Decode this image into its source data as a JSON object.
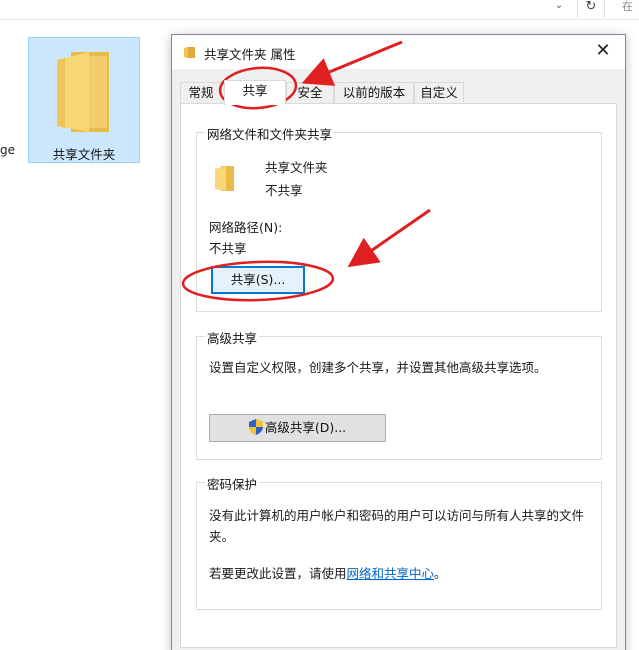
{
  "explorer": {
    "address_chevron": "⌄",
    "refresh_glyph": "↻",
    "search_stub": "在",
    "partial_item_text": "ge",
    "folder_label": "共享文件夹"
  },
  "dialog": {
    "title": "共享文件夹 属性",
    "close_glyph": "✕",
    "tabs": [
      {
        "label": "常规"
      },
      {
        "label": "共享"
      },
      {
        "label": "安全"
      },
      {
        "label": "以前的版本"
      },
      {
        "label": "自定义"
      }
    ],
    "network_sharing": {
      "legend": "网络文件和文件夹共享",
      "folder_name": "共享文件夹",
      "share_status": "不共享",
      "network_path_label": "网络路径(N):",
      "network_path_value": "不共享",
      "share_button": "共享(S)..."
    },
    "advanced_sharing": {
      "legend": "高级共享",
      "description": "设置自定义权限，创建多个共享，并设置其他高级共享选项。",
      "button": "高级共享(D)..."
    },
    "password_protection": {
      "legend": "密码保护",
      "description": "没有此计算机的用户帐户和密码的用户可以访问与所有人共享的文件夹。",
      "change_prefix": "若要更改此设置，请使用",
      "link": "网络和共享中心",
      "change_suffix": "。"
    }
  },
  "colors": {
    "annotation_red": "#e02020",
    "link_blue": "#0066cc",
    "folder_yellow": "#f8d775",
    "focus_blue": "#0078d7"
  }
}
